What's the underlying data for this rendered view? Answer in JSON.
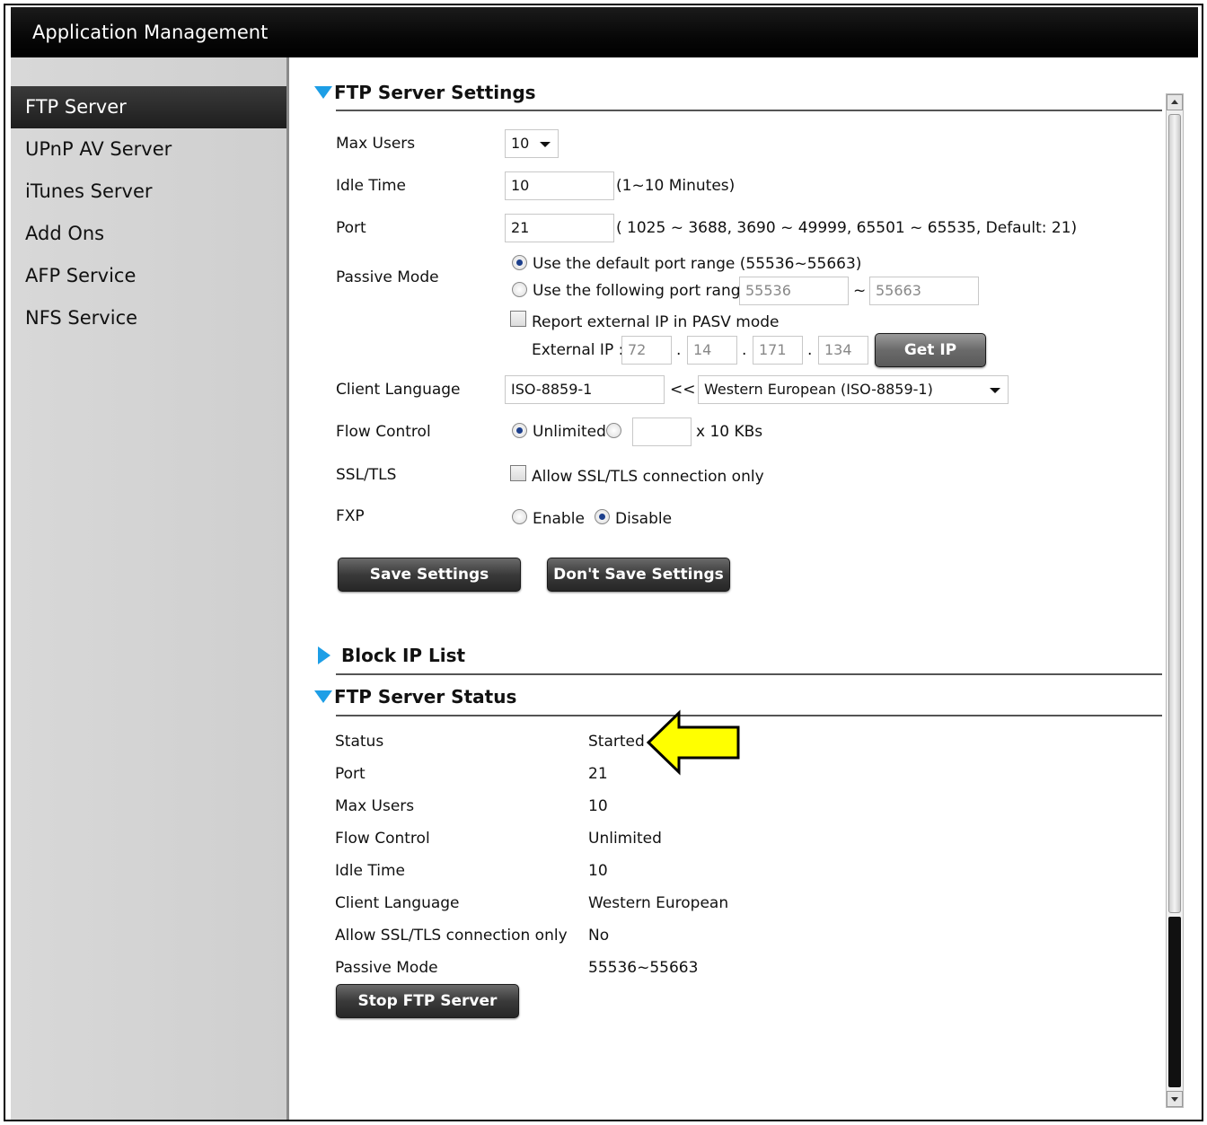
{
  "window": {
    "title": "Application Management"
  },
  "sidebar": {
    "items": [
      {
        "label": "FTP Server",
        "active": true
      },
      {
        "label": "UPnP AV Server"
      },
      {
        "label": "iTunes Server"
      },
      {
        "label": "Add Ons"
      },
      {
        "label": "AFP Service"
      },
      {
        "label": "NFS Service"
      }
    ]
  },
  "settings": {
    "header": "FTP Server Settings",
    "max_users": {
      "label": "Max Users",
      "value": "10"
    },
    "idle_time": {
      "label": "Idle Time",
      "value": "10",
      "hint": "(1~10 Minutes)"
    },
    "port": {
      "label": "Port",
      "value": "21",
      "hint": "( 1025 ~ 3688, 3690 ~ 49999, 65501 ~ 65535, Default: 21)"
    },
    "passive_mode": {
      "label": "Passive Mode",
      "option_default": "Use the default port range (55536~55663)",
      "option_custom": "Use the following port range:",
      "range_from": "55536",
      "range_sep": "~",
      "range_to": "55663",
      "report_external": "Report external IP in PASV mode",
      "external_ip_label": "External IP :",
      "ip": [
        "72",
        "14",
        "171",
        "134"
      ],
      "ip_dot": ".",
      "get_ip_button": "Get IP"
    },
    "client_language": {
      "label": "Client Language",
      "value": "ISO-8859-1",
      "sep": "<<",
      "selected": "Western European (ISO-8859-1)"
    },
    "flow_control": {
      "label": "Flow Control",
      "option_unlimited": "Unlimited",
      "value": "",
      "unit": "x 10 KBs"
    },
    "ssl": {
      "label": "SSL/TLS",
      "option": "Allow SSL/TLS connection only"
    },
    "fxp": {
      "label": "FXP",
      "enable": "Enable",
      "disable": "Disable"
    },
    "save_button": "Save Settings",
    "dont_save_button": "Don't Save Settings"
  },
  "block_ip": {
    "header": "Block IP List"
  },
  "status": {
    "header": "FTP Server Status",
    "rows": [
      {
        "label": "Status",
        "value": "Started"
      },
      {
        "label": "Port",
        "value": "21"
      },
      {
        "label": "Max Users",
        "value": "10"
      },
      {
        "label": "Flow Control",
        "value": "Unlimited"
      },
      {
        "label": "Idle Time",
        "value": "10"
      },
      {
        "label": "Client Language",
        "value": "Western European"
      },
      {
        "label": "Allow SSL/TLS connection only",
        "value": "No"
      },
      {
        "label": "Passive Mode",
        "value": "55536~55663"
      }
    ],
    "stop_button": "Stop FTP Server"
  },
  "colors": {
    "accent": "#1d9ee6",
    "callout": "#ffff00"
  }
}
